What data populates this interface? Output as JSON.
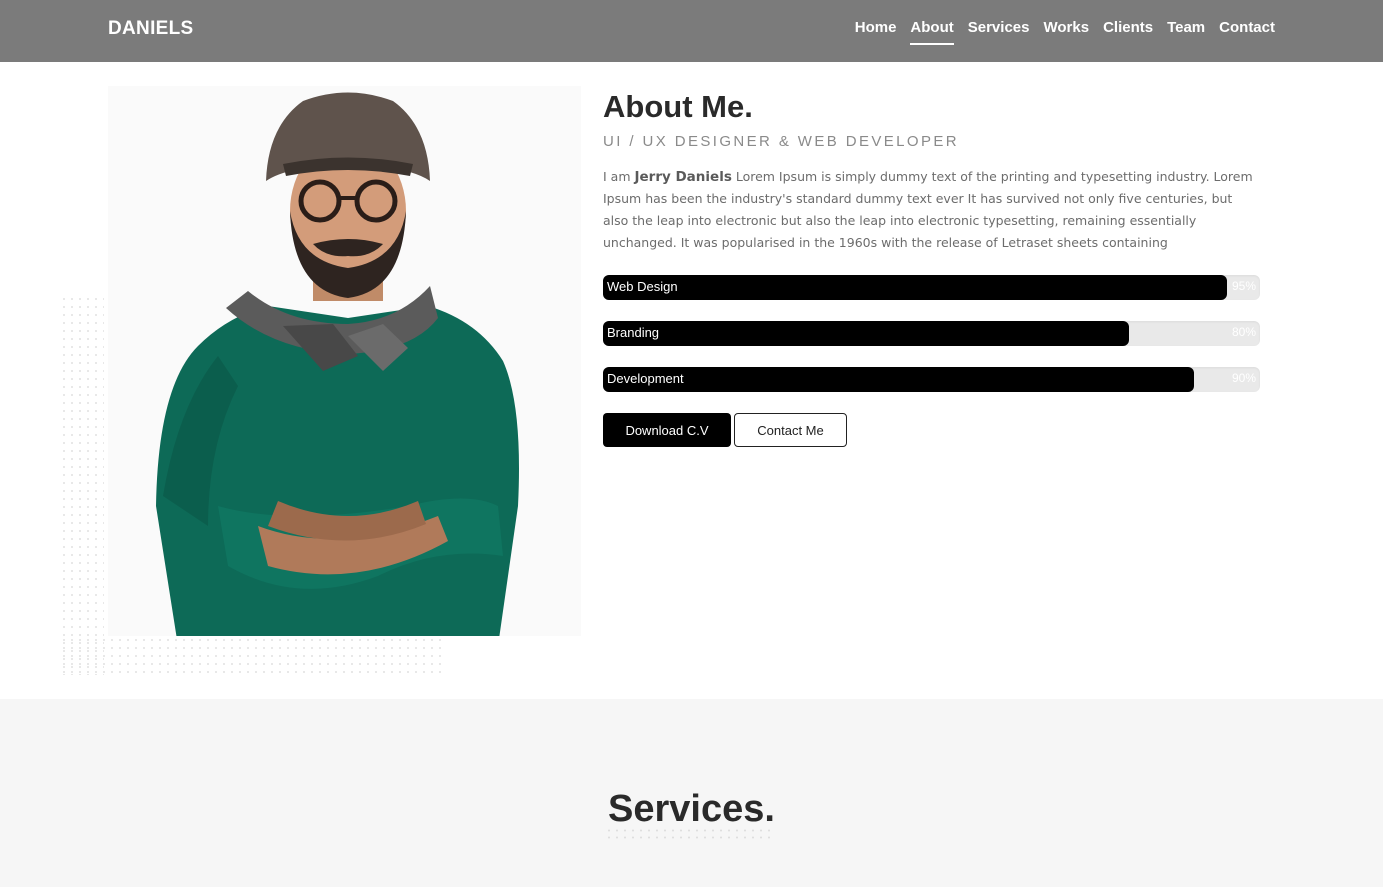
{
  "header": {
    "brand": "DANIELS",
    "nav": [
      {
        "label": "Home",
        "active": false
      },
      {
        "label": "About",
        "active": true
      },
      {
        "label": "Services",
        "active": false
      },
      {
        "label": "Works",
        "active": false
      },
      {
        "label": "Clients",
        "active": false
      },
      {
        "label": "Team",
        "active": false
      },
      {
        "label": "Contact",
        "active": false
      }
    ]
  },
  "about": {
    "title": "About Me.",
    "subtitle": "UI / UX DESIGNER & WEB DEVELOPER",
    "intro_prefix": "I am ",
    "name": "Jerry Daniels",
    "body": " Lorem Ipsum is simply dummy text of the printing and typesetting industry. Lorem Ipsum has been the industry's standard dummy text ever It has survived not only five centuries, but also the leap into electronic but also the leap into electronic typesetting, remaining essentially unchanged. It was popularised in the 1960s with the release of Letraset sheets containing",
    "skills": [
      {
        "name": "Web Design",
        "percent_label": "95%",
        "value": 95
      },
      {
        "name": "Branding",
        "percent_label": "80%",
        "value": 80
      },
      {
        "name": "Development",
        "percent_label": "90%",
        "value": 90
      }
    ],
    "download_label": "Download C.V",
    "contact_label": "Contact Me",
    "photo": "man-with-hat-glasses-scarf-green-sweater-arms-crossed"
  },
  "services": {
    "title": "Services."
  },
  "colors": {
    "navbar": "#7b7b7b",
    "accent": "#000000",
    "services_bg": "#f6f6f6"
  }
}
